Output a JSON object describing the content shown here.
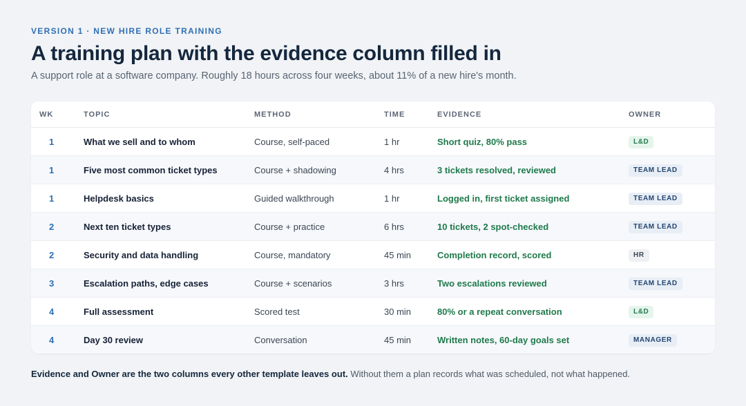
{
  "header": {
    "eyebrow": "VERSION 1 · NEW HIRE ROLE TRAINING",
    "title": "A training plan with the evidence column filled in",
    "subtitle": "A support role at a software company. Roughly 18 hours across four weeks, about 11% of a new hire's month."
  },
  "table": {
    "columns": {
      "wk": "WK",
      "topic": "TOPIC",
      "method": "METHOD",
      "time": "TIME",
      "evidence": "EVIDENCE",
      "owner": "OWNER"
    },
    "rows": [
      {
        "wk": "1",
        "topic": "What we sell and to whom",
        "method": "Course, self-paced",
        "time": "1 hr",
        "evidence": "Short quiz, 80% pass",
        "owner": "L&D"
      },
      {
        "wk": "1",
        "topic": "Five most common ticket types",
        "method": "Course + shadowing",
        "time": "4 hrs",
        "evidence": "3 tickets resolved, reviewed",
        "owner": "TEAM LEAD"
      },
      {
        "wk": "1",
        "topic": "Helpdesk basics",
        "method": "Guided walkthrough",
        "time": "1 hr",
        "evidence": "Logged in, first ticket assigned",
        "owner": "TEAM LEAD"
      },
      {
        "wk": "2",
        "topic": "Next ten ticket types",
        "method": "Course + practice",
        "time": "6 hrs",
        "evidence": "10 tickets, 2 spot-checked",
        "owner": "TEAM LEAD"
      },
      {
        "wk": "2",
        "topic": "Security and data handling",
        "method": "Course, mandatory",
        "time": "45 min",
        "evidence": "Completion record, scored",
        "owner": "HR"
      },
      {
        "wk": "3",
        "topic": "Escalation paths, edge cases",
        "method": "Course + scenarios",
        "time": "3 hrs",
        "evidence": "Two escalations reviewed",
        "owner": "TEAM LEAD"
      },
      {
        "wk": "4",
        "topic": "Full assessment",
        "method": "Scored test",
        "time": "30 min",
        "evidence": "80% or a repeat conversation",
        "owner": "L&D"
      },
      {
        "wk": "4",
        "topic": "Day 30 review",
        "method": "Conversation",
        "time": "45 min",
        "evidence": "Written notes, 60-day goals set",
        "owner": "MANAGER"
      }
    ]
  },
  "footer": {
    "bold": "Evidence and Owner are the two columns every other template leaves out.",
    "rest": " Without them a plan records what was scheduled, not what happened."
  },
  "colors": {
    "accent": "#2f6fb4",
    "evidence_green": "#1f7a4c",
    "badge_green_bg": "#e6f5ec",
    "badge_blue_bg": "#e8eef6",
    "badge_gray_bg": "#eef0f3"
  }
}
